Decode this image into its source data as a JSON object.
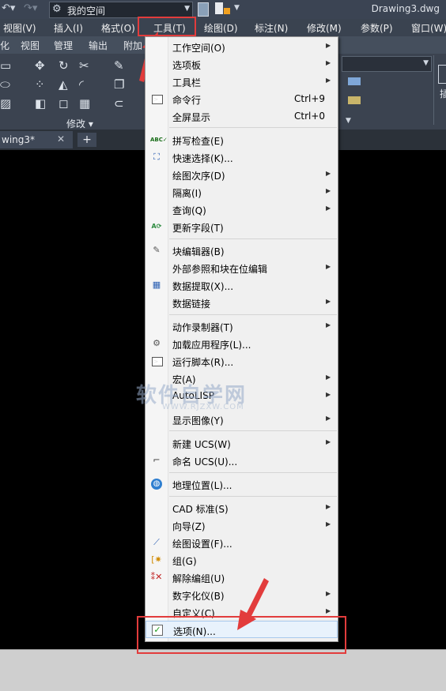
{
  "quick_access": {
    "workspace": "我的空间",
    "document_title": "Drawing3.dwg"
  },
  "menubar": {
    "items": [
      "视图(V)",
      "插入(I)",
      "格式(O)",
      "工具(T)",
      "绘图(D)",
      "标注(N)",
      "修改(M)",
      "参数(P)",
      "窗口(W)"
    ]
  },
  "ribbon": {
    "tabs": [
      "化",
      "视图",
      "管理",
      "输出",
      "附加"
    ],
    "panel_modify_label": "修改",
    "right_partial_label": "插"
  },
  "file_tabs": {
    "active": "wing3*",
    "close": "✕",
    "add": "+"
  },
  "tools_menu": {
    "items": [
      {
        "label": "工作空间(O)",
        "submenu": true
      },
      {
        "label": "选项板",
        "submenu": true
      },
      {
        "label": "工具栏",
        "submenu": true
      },
      {
        "label": "命令行",
        "shortcut": "Ctrl+9",
        "icon": "command-line-icon"
      },
      {
        "label": "全屏显示",
        "shortcut": "Ctrl+0"
      },
      {
        "label": "拼写检查(E)",
        "icon": "spell-check-icon"
      },
      {
        "label": "快速选择(K)...",
        "icon": "quick-select-icon"
      },
      {
        "label": "绘图次序(D)",
        "submenu": true
      },
      {
        "label": "隔离(I)",
        "submenu": true
      },
      {
        "label": "查询(Q)",
        "submenu": true
      },
      {
        "label": "更新字段(T)",
        "icon": "update-field-icon"
      },
      {
        "label": "块编辑器(B)",
        "icon": "block-editor-icon"
      },
      {
        "label": "外部参照和块在位编辑",
        "submenu": true
      },
      {
        "label": "数据提取(X)...",
        "icon": "data-extraction-icon"
      },
      {
        "label": "数据链接",
        "submenu": true
      },
      {
        "label": "动作录制器(T)",
        "submenu": true
      },
      {
        "label": "加载应用程序(L)...",
        "icon": "load-application-icon"
      },
      {
        "label": "运行脚本(R)...",
        "icon": "run-script-icon"
      },
      {
        "label": "宏(A)",
        "submenu": true
      },
      {
        "label": "AutoLISP",
        "submenu": true
      },
      {
        "label": "显示图像(Y)",
        "submenu": true
      },
      {
        "label": "新建 UCS(W)",
        "submenu": true
      },
      {
        "label": "命名 UCS(U)...",
        "icon": "named-ucs-icon"
      },
      {
        "label": "地理位置(L)...",
        "icon": "globe-icon"
      },
      {
        "label": "CAD 标准(S)",
        "submenu": true
      },
      {
        "label": "向导(Z)",
        "submenu": true
      },
      {
        "label": "绘图设置(F)...",
        "icon": "drafting-settings-icon"
      },
      {
        "label": "组(G)",
        "icon": "group-icon"
      },
      {
        "label": "解除编组(U)",
        "icon": "ungroup-icon"
      },
      {
        "label": "数字化仪(B)",
        "submenu": true
      },
      {
        "label": "自定义(C)",
        "submenu": true
      },
      {
        "label": "选项(N)...",
        "icon": "options-check-icon"
      }
    ]
  },
  "watermark": {
    "text": "软件自学网",
    "sub": "WWW.RJZXW.COM"
  },
  "colors": {
    "accent_red": "#e23c3c",
    "menu_bg": "#f0f0f0",
    "titlebar": "#3b4453"
  }
}
